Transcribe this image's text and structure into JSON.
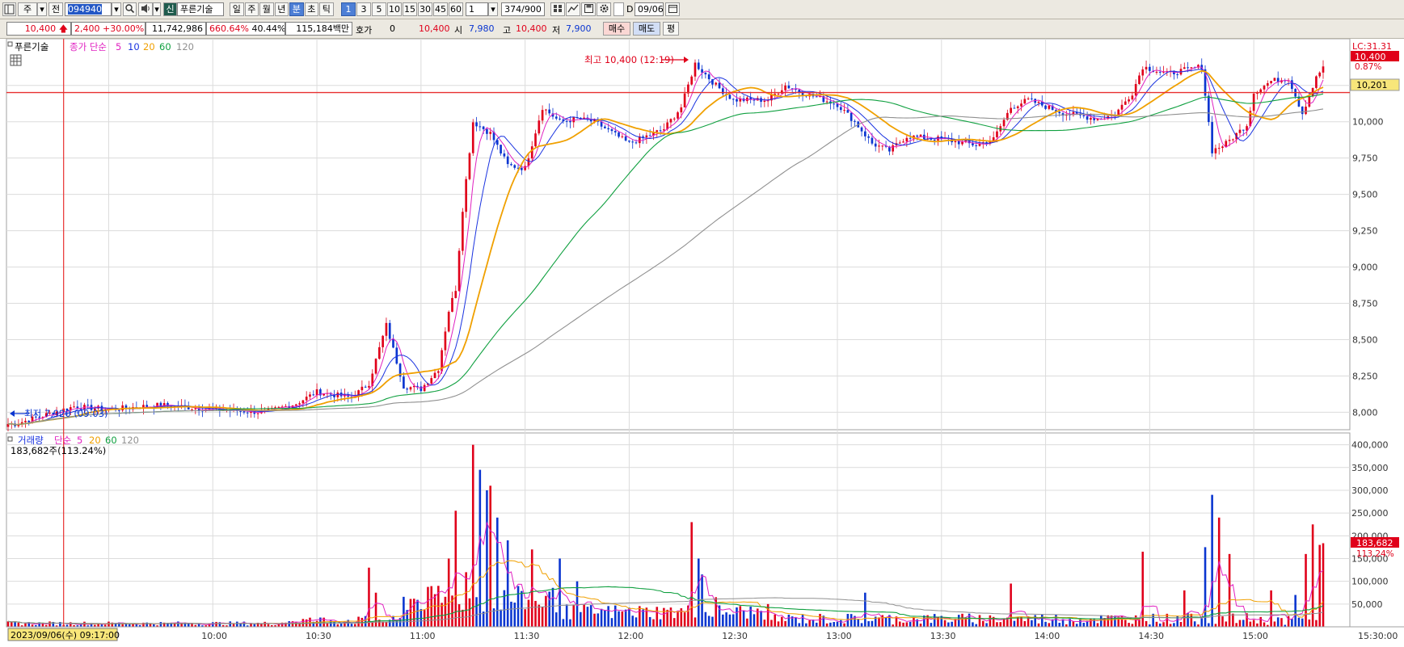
{
  "toolbar": {
    "market_btn": "주",
    "prev_btn": "전",
    "code": "094940",
    "tag_new": "신",
    "stock_name": "푸른기술",
    "periods": [
      "일",
      "주",
      "월",
      "년",
      "분",
      "초",
      "틱"
    ],
    "active_period": "분",
    "intervals": [
      "1",
      "3",
      "5",
      "10",
      "15",
      "30",
      "45",
      "60"
    ],
    "active_interval": "1",
    "multiplier": "1",
    "count": "374/900",
    "check_label": "D",
    "date": "09/06"
  },
  "quote": {
    "price": "10,400",
    "change": "2,400",
    "change_pct": "+30.00%",
    "volume": "11,742,986",
    "vol_ratio": "660.64%",
    "turnover": "40.44%",
    "amount": "115,184백만",
    "hoga_label": "호가",
    "hoga_value": "0",
    "hoga_price": "10,400",
    "open_label": "시",
    "open": "7,980",
    "high_label": "고",
    "high": "10,400",
    "low_label": "저",
    "low": "7,900",
    "buy_btn": "매수",
    "sell_btn": "매도",
    "avg_btn": "평"
  },
  "icons": {
    "layout": "layout-icon",
    "search": "search-icon",
    "speaker": "speaker-icon",
    "grid": "grid-icon",
    "chart_tools": "chart-tools-icon",
    "save": "save-icon",
    "settings": "settings-icon",
    "calendar": "calendar-icon"
  },
  "colors": {
    "up": "#e0001a",
    "down": "#0a35d0",
    "ma5": "#e020c0",
    "ma10": "#1a33e0",
    "ma20": "#f0a000",
    "ma60": "#10a040",
    "ma120": "#909090",
    "level_line": "#e83030"
  },
  "price_panel": {
    "legend_name": "푸른기술",
    "legend_type": "종가 단순",
    "ma_labels": [
      "5",
      "10",
      "20",
      "60",
      "120"
    ],
    "high_annotation": "최고 10,400 (12:19)",
    "low_annotation": "최저 7,920 (09:03)",
    "lc_label": "LC:31.31",
    "current_tag": "10,400",
    "current_pct": "0.87%",
    "level_tag": "10,201"
  },
  "volume_panel": {
    "legend_name": "거래량",
    "legend_type": "단순",
    "ma_labels": [
      "5",
      "20",
      "60",
      "120"
    ],
    "info": "183,682주(113.24%)",
    "current_tag": "183,682",
    "current_pct": "113.24%"
  },
  "crosshair_date": "2023/09/06(수) 09:17:00",
  "chart_data": [
    {
      "type": "candlestick",
      "title": "푸른기술 1분봉",
      "x_ticks": [
        "9:30",
        "10:00",
        "10:30",
        "11:00",
        "11:30",
        "12:00",
        "12:30",
        "13:00",
        "13:30",
        "14:00",
        "14:30",
        "15:00",
        "15:30:00"
      ],
      "ylim": [
        7880,
        10560
      ],
      "y_ticks": [
        8000,
        8250,
        8500,
        8750,
        9000,
        9250,
        9500,
        9750,
        10000,
        10250
      ],
      "y_tick_labels": [
        "8,000",
        "8,250",
        "8,500",
        "8,750",
        "9,000",
        "9,250",
        "9,500",
        "9,750",
        "10,000",
        "10,250"
      ],
      "ohlc_keypoints": [
        [
          "9:03",
          7920
        ],
        [
          "9:20",
          8040
        ],
        [
          "9:30",
          8020
        ],
        [
          "9:45",
          8050
        ],
        [
          "10:00",
          8020
        ],
        [
          "10:15",
          8000
        ],
        [
          "10:24",
          8060
        ],
        [
          "10:30",
          8140
        ],
        [
          "10:40",
          8100
        ],
        [
          "10:45",
          8200
        ],
        [
          "10:50",
          8600
        ],
        [
          "10:55",
          8180
        ],
        [
          "11:00",
          8160
        ],
        [
          "11:05",
          8300
        ],
        [
          "11:08",
          8700
        ],
        [
          "11:10",
          8850
        ],
        [
          "11:12",
          9400
        ],
        [
          "11:15",
          10000
        ],
        [
          "11:20",
          9920
        ],
        [
          "11:25",
          9700
        ],
        [
          "11:30",
          9680
        ],
        [
          "11:35",
          10100
        ],
        [
          "11:40",
          10000
        ],
        [
          "11:45",
          10020
        ],
        [
          "11:50",
          10000
        ],
        [
          "12:00",
          9850
        ],
        [
          "12:10",
          9950
        ],
        [
          "12:15",
          10100
        ],
        [
          "12:19",
          10400
        ],
        [
          "12:25",
          10250
        ],
        [
          "12:30",
          10150
        ],
        [
          "12:40",
          10150
        ],
        [
          "12:45",
          10250
        ],
        [
          "12:50",
          10200
        ],
        [
          "13:00",
          10120
        ],
        [
          "13:05",
          10000
        ],
        [
          "13:10",
          9850
        ],
        [
          "13:15",
          9800
        ],
        [
          "13:20",
          9900
        ],
        [
          "13:30",
          9880
        ],
        [
          "13:40",
          9840
        ],
        [
          "13:45",
          9880
        ],
        [
          "13:50",
          10100
        ],
        [
          "13:55",
          10150
        ],
        [
          "14:05",
          10060
        ],
        [
          "14:15",
          10020
        ],
        [
          "14:20",
          10050
        ],
        [
          "14:25",
          10200
        ],
        [
          "14:28",
          10380
        ],
        [
          "14:35",
          10330
        ],
        [
          "14:45",
          10380
        ],
        [
          "14:48",
          9800
        ],
        [
          "14:52",
          9850
        ],
        [
          "14:58",
          9980
        ],
        [
          "15:00",
          10200
        ],
        [
          "15:05",
          10280
        ],
        [
          "15:10",
          10300
        ],
        [
          "15:14",
          10060
        ],
        [
          "15:18",
          10300
        ],
        [
          "15:20",
          10380
        ]
      ],
      "ma": {
        "5": true,
        "10": true,
        "20": true,
        "60": true,
        "120": true
      },
      "level_line": 10201,
      "grid": true
    },
    {
      "type": "bar",
      "title": "거래량",
      "ylim": [
        0,
        410000
      ],
      "y_ticks": [
        50000,
        100000,
        150000,
        200000,
        250000,
        300000,
        350000,
        400000
      ],
      "y_tick_labels": [
        "50,000",
        "100,000",
        "150,000",
        "200,000",
        "250,000",
        "300,000",
        "350,000",
        "400,000"
      ],
      "volume_spikes": [
        [
          "10:45",
          130000
        ],
        [
          "10:47",
          75000
        ],
        [
          "11:05",
          90000
        ],
        [
          "11:08",
          150000
        ],
        [
          "11:10",
          255000
        ],
        [
          "11:13",
          120000
        ],
        [
          "11:15",
          400000
        ],
        [
          "11:17",
          345000
        ],
        [
          "11:19",
          300000
        ],
        [
          "11:20",
          310000
        ],
        [
          "11:22",
          240000
        ],
        [
          "11:25",
          190000
        ],
        [
          "11:32",
          170000
        ],
        [
          "11:40",
          150000
        ],
        [
          "11:45",
          100000
        ],
        [
          "12:18",
          230000
        ],
        [
          "12:20",
          150000
        ],
        [
          "12:21",
          115000
        ],
        [
          "12:25",
          65000
        ],
        [
          "13:08",
          75000
        ],
        [
          "13:50",
          95000
        ],
        [
          "14:28",
          165000
        ],
        [
          "14:40",
          80000
        ],
        [
          "14:46",
          175000
        ],
        [
          "14:48",
          290000
        ],
        [
          "14:50",
          240000
        ],
        [
          "14:53",
          160000
        ],
        [
          "15:05",
          80000
        ],
        [
          "15:12",
          70000
        ],
        [
          "15:15",
          160000
        ],
        [
          "15:17",
          225000
        ],
        [
          "15:19",
          180000
        ]
      ],
      "current_volume": 183682,
      "grid": true
    }
  ]
}
